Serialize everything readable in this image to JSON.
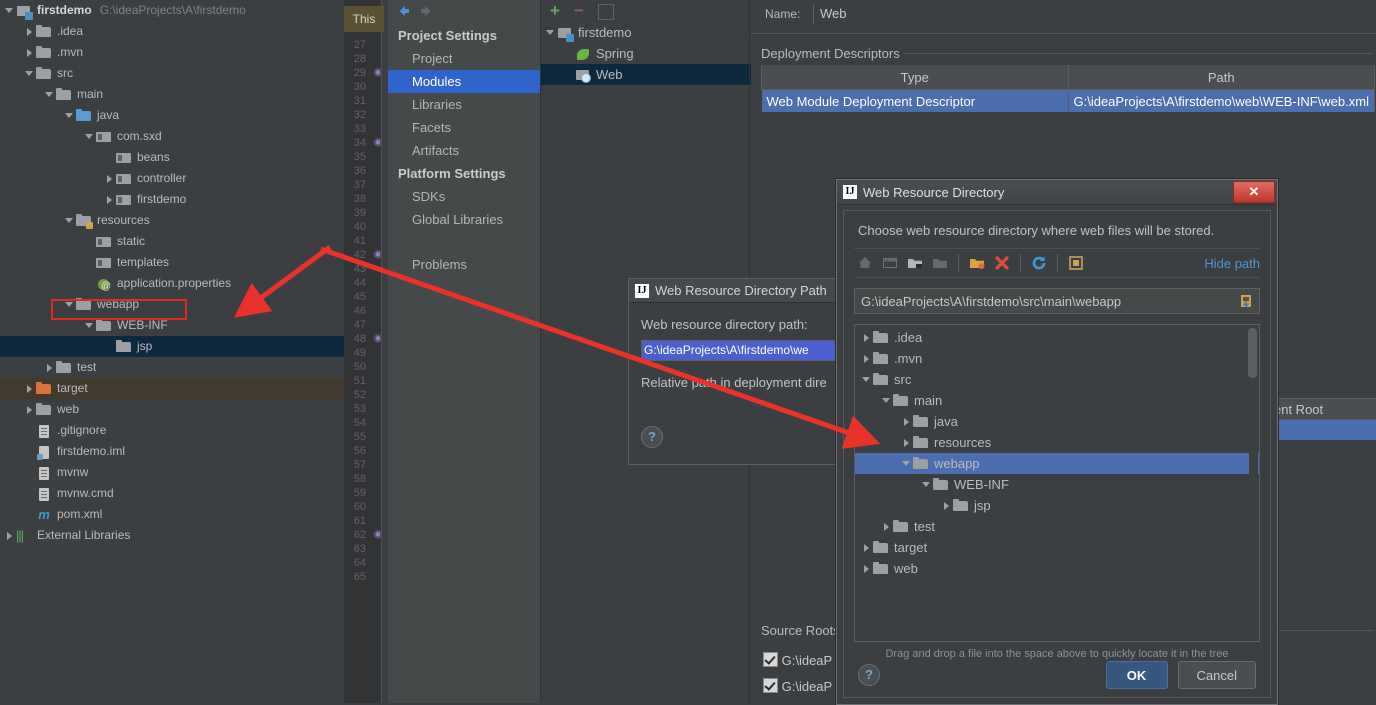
{
  "project_panel": {
    "rows": [
      {
        "indent": 0,
        "arrow": "down",
        "icon": "module-root-icon",
        "label": "firstdemo",
        "bold": true,
        "path": "G:\\ideaProjects\\A\\firstdemo",
        "sel": false
      },
      {
        "indent": 1,
        "arrow": "right",
        "icon": "folder-icon",
        "label": ".idea",
        "sel": false
      },
      {
        "indent": 1,
        "arrow": "right",
        "icon": "folder-icon",
        "label": ".mvn",
        "sel": false
      },
      {
        "indent": 1,
        "arrow": "down",
        "icon": "folder-icon",
        "label": "src",
        "sel": false
      },
      {
        "indent": 2,
        "arrow": "down",
        "icon": "folder-icon",
        "label": "main",
        "sel": false
      },
      {
        "indent": 3,
        "arrow": "down",
        "icon": "folder-source-icon",
        "label": "java",
        "sel": false
      },
      {
        "indent": 4,
        "arrow": "down",
        "icon": "package-icon",
        "label": "com.sxd",
        "sel": false
      },
      {
        "indent": 5,
        "arrow": "none",
        "icon": "package-icon",
        "label": "beans",
        "sel": false
      },
      {
        "indent": 5,
        "arrow": "right",
        "icon": "package-icon",
        "label": "controller",
        "sel": false
      },
      {
        "indent": 5,
        "arrow": "right",
        "icon": "package-icon",
        "label": "firstdemo",
        "sel": false
      },
      {
        "indent": 3,
        "arrow": "down",
        "icon": "folder-resources-icon",
        "label": "resources",
        "sel": false
      },
      {
        "indent": 4,
        "arrow": "none",
        "icon": "package-icon",
        "label": "static",
        "sel": false
      },
      {
        "indent": 4,
        "arrow": "none",
        "icon": "package-icon",
        "label": "templates",
        "sel": false
      },
      {
        "indent": 4,
        "arrow": "none",
        "icon": "properties-file-icon",
        "label": "application.properties",
        "sel": false
      },
      {
        "indent": 3,
        "arrow": "down",
        "icon": "folder-icon",
        "label": "webapp",
        "sel": false,
        "highlight": true
      },
      {
        "indent": 4,
        "arrow": "down",
        "icon": "folder-icon",
        "label": "WEB-INF",
        "sel": false
      },
      {
        "indent": 5,
        "arrow": "none",
        "icon": "folder-icon",
        "label": "jsp",
        "sel": true
      },
      {
        "indent": 2,
        "arrow": "right",
        "icon": "folder-icon",
        "label": "test",
        "sel": false
      },
      {
        "indent": 1,
        "arrow": "right",
        "icon": "folder-excluded-icon",
        "label": "target",
        "sel": false,
        "excluded": true
      },
      {
        "indent": 1,
        "arrow": "right",
        "icon": "folder-icon",
        "label": "web",
        "sel": false
      },
      {
        "indent": 1,
        "arrow": "none",
        "icon": "file-icon",
        "label": ".gitignore",
        "sel": false
      },
      {
        "indent": 1,
        "arrow": "none",
        "icon": "iml-file-icon",
        "label": "firstdemo.iml",
        "sel": false
      },
      {
        "indent": 1,
        "arrow": "none",
        "icon": "file-icon",
        "label": "mvnw",
        "sel": false
      },
      {
        "indent": 1,
        "arrow": "none",
        "icon": "file-icon",
        "label": "mvnw.cmd",
        "sel": false
      },
      {
        "indent": 1,
        "arrow": "none",
        "icon": "maven-file-icon",
        "label": "pom.xml",
        "sel": false
      },
      {
        "indent": 0,
        "arrow": "right",
        "icon": "external-libraries-icon",
        "label": "External Libraries",
        "sel": false
      }
    ]
  },
  "editor": {
    "tab_label": "This",
    "line_numbers": [
      27,
      28,
      29,
      30,
      31,
      32,
      33,
      34,
      35,
      36,
      37,
      38,
      39,
      40,
      41,
      42,
      43,
      44,
      45,
      46,
      47,
      48,
      49,
      50,
      51,
      52,
      53,
      54,
      55,
      56,
      57,
      58,
      59,
      60,
      61,
      62,
      63,
      64,
      65
    ],
    "marked_lines": [
      29,
      34,
      42,
      48,
      62
    ]
  },
  "settings": {
    "nav": [
      {
        "label": "Project Settings",
        "group": true
      },
      {
        "label": "Project",
        "group": false,
        "selected": false
      },
      {
        "label": "Modules",
        "group": false,
        "selected": true
      },
      {
        "label": "Libraries",
        "group": false,
        "selected": false
      },
      {
        "label": "Facets",
        "group": false,
        "selected": false
      },
      {
        "label": "Artifacts",
        "group": false,
        "selected": false
      },
      {
        "label": "Platform Settings",
        "group": true
      },
      {
        "label": "SDKs",
        "group": false,
        "selected": false
      },
      {
        "label": "Global Libraries",
        "group": false,
        "selected": false
      },
      {
        "label": "Problems",
        "group": false,
        "selected": false,
        "spaced": true
      }
    ],
    "nav_toolbar": [
      "back-icon",
      "forward-icon"
    ],
    "module_toolbar": [
      "add-icon",
      "remove-icon",
      "copy-icon"
    ],
    "module_tree": [
      {
        "indent": 0,
        "arrow": "down",
        "icon": "module-icon",
        "label": "firstdemo",
        "sel": false
      },
      {
        "indent": 1,
        "arrow": "none",
        "icon": "spring-facet-icon",
        "label": "Spring",
        "sel": false
      },
      {
        "indent": 1,
        "arrow": "none",
        "icon": "web-facet-icon",
        "label": "Web",
        "sel": true
      }
    ],
    "detail": {
      "name_label": "Name:",
      "name_value": "Web",
      "deployment_descriptors_title": "Deployment Descriptors",
      "columns": [
        "Type",
        "Path"
      ],
      "rows": [
        {
          "type": "Web Module Deployment Descriptor",
          "path": "G:\\ideaProjects\\A\\firstdemo\\web\\WEB-INF\\web.xml",
          "selected": true
        }
      ],
      "web_resource_col_fragment": "ent Root",
      "source_roots_title": "Source Roots",
      "source_root_items": [
        "G:\\ideaP",
        "G:\\ideaP"
      ]
    }
  },
  "wrdp_dialog": {
    "title": "Web Resource Directory Path",
    "logo": "IJ",
    "path_label": "Web resource directory path:",
    "path_value": "G:\\ideaProjects\\A\\firstdemo\\we",
    "relative_label": "Relative path in deployment dire",
    "help_glyph": "?"
  },
  "wrd_dialog": {
    "title": "Web Resource Directory",
    "logo": "IJ",
    "close_glyph": "✕",
    "prompt": "Choose web resource directory where web files will be stored.",
    "toolbar_icons": [
      "home-icon",
      "desktop-icon",
      "project-folder-icon",
      "module-folder-icon",
      "new-folder-icon",
      "delete-icon",
      "refresh-icon",
      "show-hidden-icon"
    ],
    "hide_path_label": "Hide path",
    "path_value": "G:\\ideaProjects\\A\\firstdemo\\src\\main\\webapp",
    "path_field_icon": "paste-icon",
    "tree": [
      {
        "indent": 0,
        "arrow": "right",
        "label": ".idea",
        "sel": false
      },
      {
        "indent": 0,
        "arrow": "right",
        "label": ".mvn",
        "sel": false
      },
      {
        "indent": 0,
        "arrow": "down",
        "label": "src",
        "sel": false
      },
      {
        "indent": 1,
        "arrow": "down",
        "label": "main",
        "sel": false
      },
      {
        "indent": 2,
        "arrow": "right",
        "label": "java",
        "sel": false
      },
      {
        "indent": 2,
        "arrow": "right",
        "label": "resources",
        "sel": false
      },
      {
        "indent": 2,
        "arrow": "down",
        "label": "webapp",
        "sel": true
      },
      {
        "indent": 3,
        "arrow": "down",
        "label": "WEB-INF",
        "sel": false
      },
      {
        "indent": 4,
        "arrow": "right",
        "label": "jsp",
        "sel": false
      },
      {
        "indent": 1,
        "arrow": "right",
        "label": "test",
        "sel": false
      },
      {
        "indent": 0,
        "arrow": "right",
        "label": "target",
        "sel": false
      },
      {
        "indent": 0,
        "arrow": "right",
        "label": "web",
        "sel": false
      }
    ],
    "drag_hint": "Drag and drop a file into the space above to quickly locate it in the tree",
    "help_glyph": "?",
    "ok_label": "OK",
    "cancel_label": "Cancel"
  },
  "colors": {
    "background": "#3c3f41",
    "selection_blue": "#4b6eaf",
    "nav_selection": "#2f65ca",
    "tree_selection_dark": "#0d293e",
    "annotation_red": "#e8322a",
    "link_blue": "#4d94d6",
    "close_red": "#c0392b"
  }
}
